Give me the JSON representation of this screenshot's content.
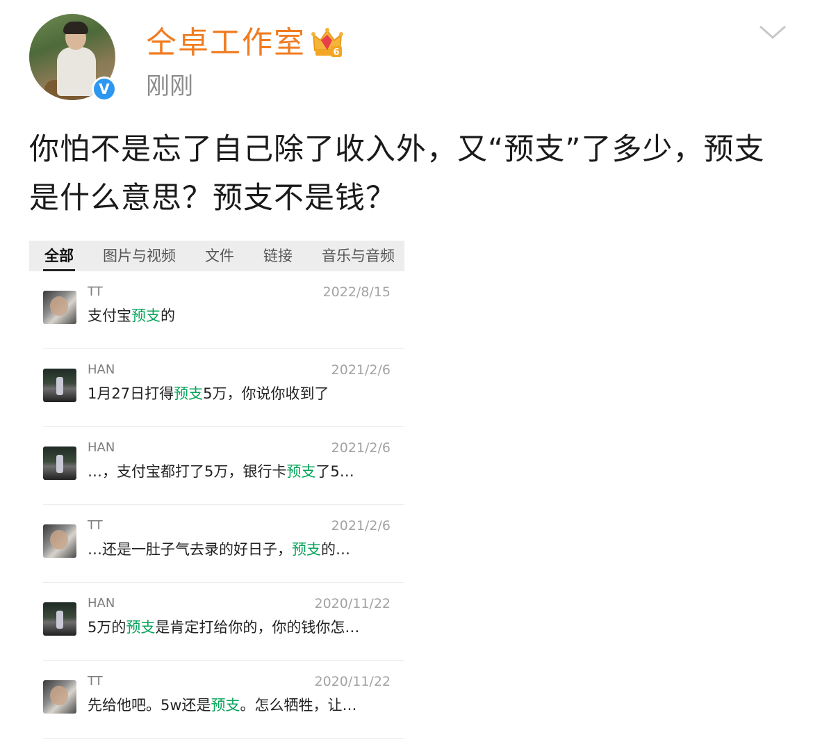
{
  "post": {
    "username": "仝卓工作室",
    "time": "刚刚",
    "text": "你怕不是忘了自己除了收入外，又“预支”了多少，预支是什么意思？预支不是钱？"
  },
  "badges": {
    "vip_level": "6",
    "verified": "V"
  },
  "colors": {
    "username": "#f07c21",
    "verified": "#2c97f1",
    "keyword": "#07a35a"
  },
  "chat_tabs": [
    "全部",
    "图片与视频",
    "文件",
    "链接",
    "音乐与音频"
  ],
  "messages": [
    {
      "sender": "TT",
      "date": "2022/8/15",
      "before": "支付宝",
      "kw": "预支",
      "after": "的",
      "avatar": "tt"
    },
    {
      "sender": "HAN",
      "date": "2021/2/6",
      "before": "1月27日打得",
      "kw": "预支",
      "after": "5万，你说你收到了",
      "avatar": "han"
    },
    {
      "sender": "HAN",
      "date": "2021/2/6",
      "before": "…，支付宝都打了5万，银行卡",
      "kw": "预支",
      "after": "了5…",
      "avatar": "han"
    },
    {
      "sender": "TT",
      "date": "2021/2/6",
      "before": "…还是一肚子气去录的好日子，",
      "kw": "预支",
      "after": "的…",
      "avatar": "tt"
    },
    {
      "sender": "HAN",
      "date": "2020/11/22",
      "before": "5万的",
      "kw": "预支",
      "after": "是肯定打给你的，你的钱你怎…",
      "avatar": "han"
    },
    {
      "sender": "TT",
      "date": "2020/11/22",
      "before": "先给他吧。5w还是",
      "kw": "预支",
      "after": "。怎么牺牲，让…",
      "avatar": "tt"
    }
  ]
}
